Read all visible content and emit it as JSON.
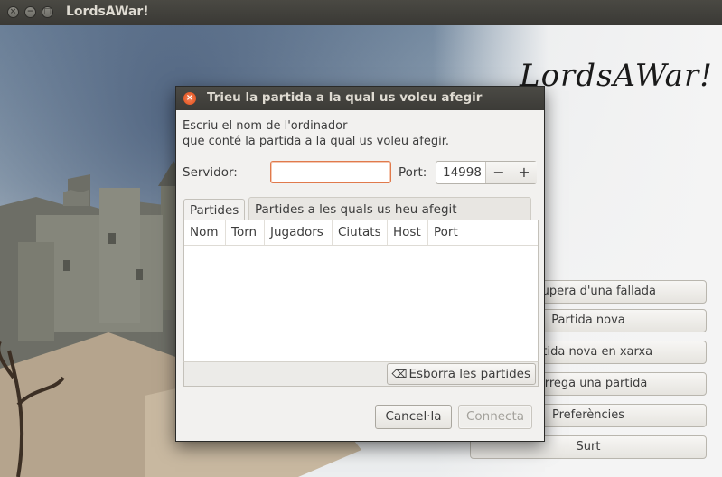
{
  "window": {
    "title": "LordsAWar!"
  },
  "logo": "LordsAWar!",
  "menu": [
    "Recupera d'una fallada",
    "Partida nova",
    "Partida nova en xarxa",
    "Carrega una partida",
    "Preferències",
    "Surt"
  ],
  "dialog": {
    "title": "Trieu la partida a la qual us voleu afegir",
    "desc_line1": "Escriu el nom de l'ordinador",
    "desc_line2": "que conté la partida a la qual us voleu afegir.",
    "server_label": "Servidor:",
    "server_value": "",
    "port_label": "Port:",
    "port_value": "14998",
    "decrement": "−",
    "increment": "+",
    "tabs": [
      "Partides",
      "Partides a les quals us heu afegit recentment"
    ],
    "columns": [
      "Nom",
      "Torn",
      "Jugadors",
      "Ciutats",
      "Host",
      "Port"
    ],
    "rows": [],
    "clear_button": "Esborra les partides",
    "cancel_button": "Cancel·la",
    "connect_button": "Connecta"
  },
  "colors": {
    "accent": "#df4b16",
    "titlebar": "#3c3b37"
  }
}
